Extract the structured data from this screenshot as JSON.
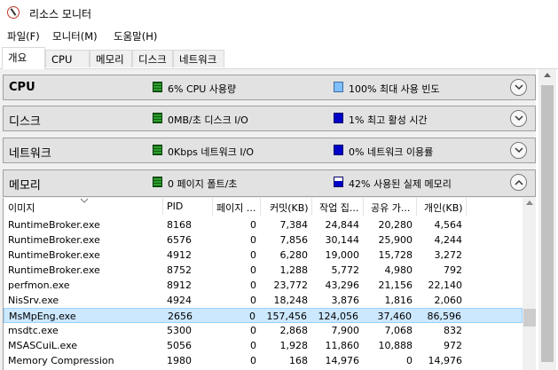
{
  "window": {
    "title": "리소스 모니터"
  },
  "menu": [
    {
      "label": "파일(F)"
    },
    {
      "label": "모니터(M)"
    },
    {
      "label": "도움말(H)"
    }
  ],
  "tabs": [
    {
      "label": "개요"
    },
    {
      "label": "CPU"
    },
    {
      "label": "메모리"
    },
    {
      "label": "디스크"
    },
    {
      "label": "네트워크"
    }
  ],
  "sections": {
    "cpu": {
      "title": "CPU",
      "stat1": "6% CPU 사용량",
      "stat2": "100% 최대 사용 빈도"
    },
    "disk": {
      "title": "디스크",
      "stat1": "0MB/초 디스크 I/O",
      "stat2": "1% 최고 활성 시간"
    },
    "network": {
      "title": "네트워크",
      "stat1": "0Kbps 네트워크 I/O",
      "stat2": "0% 네트워크 이용률"
    },
    "memory": {
      "title": "메모리",
      "stat1": "0 페이지 폴트/초",
      "stat2": "42% 사용된 실제 메모리"
    }
  },
  "memory_table": {
    "columns": [
      "이미지",
      "PID",
      "페이지 ...",
      "커밋(KB)",
      "작업 집...",
      "공유 가...",
      "개인(KB)"
    ],
    "rows": [
      [
        "RuntimeBroker.exe",
        "8168",
        "0",
        "7,384",
        "24,844",
        "20,280",
        "4,564"
      ],
      [
        "RuntimeBroker.exe",
        "6576",
        "0",
        "7,856",
        "30,144",
        "25,900",
        "4,244"
      ],
      [
        "RuntimeBroker.exe",
        "4912",
        "0",
        "6,280",
        "19,000",
        "15,728",
        "3,272"
      ],
      [
        "RuntimeBroker.exe",
        "8752",
        "0",
        "1,288",
        "5,772",
        "4,980",
        "792"
      ],
      [
        "perfmon.exe",
        "8912",
        "0",
        "23,772",
        "43,296",
        "21,156",
        "22,140"
      ],
      [
        "NisSrv.exe",
        "4924",
        "0",
        "18,248",
        "3,876",
        "1,816",
        "2,060"
      ],
      [
        "MsMpEng.exe",
        "2656",
        "0",
        "157,456",
        "124,056",
        "37,460",
        "86,596"
      ],
      [
        "msdtc.exe",
        "5300",
        "0",
        "2,868",
        "7,900",
        "7,068",
        "832"
      ],
      [
        "MSASCuiL.exe",
        "5056",
        "0",
        "1,928",
        "11,860",
        "10,888",
        "972"
      ],
      [
        "Memory Compression",
        "1980",
        "0",
        "168",
        "14,976",
        "0",
        "14,976"
      ]
    ],
    "selected_row": 6
  }
}
